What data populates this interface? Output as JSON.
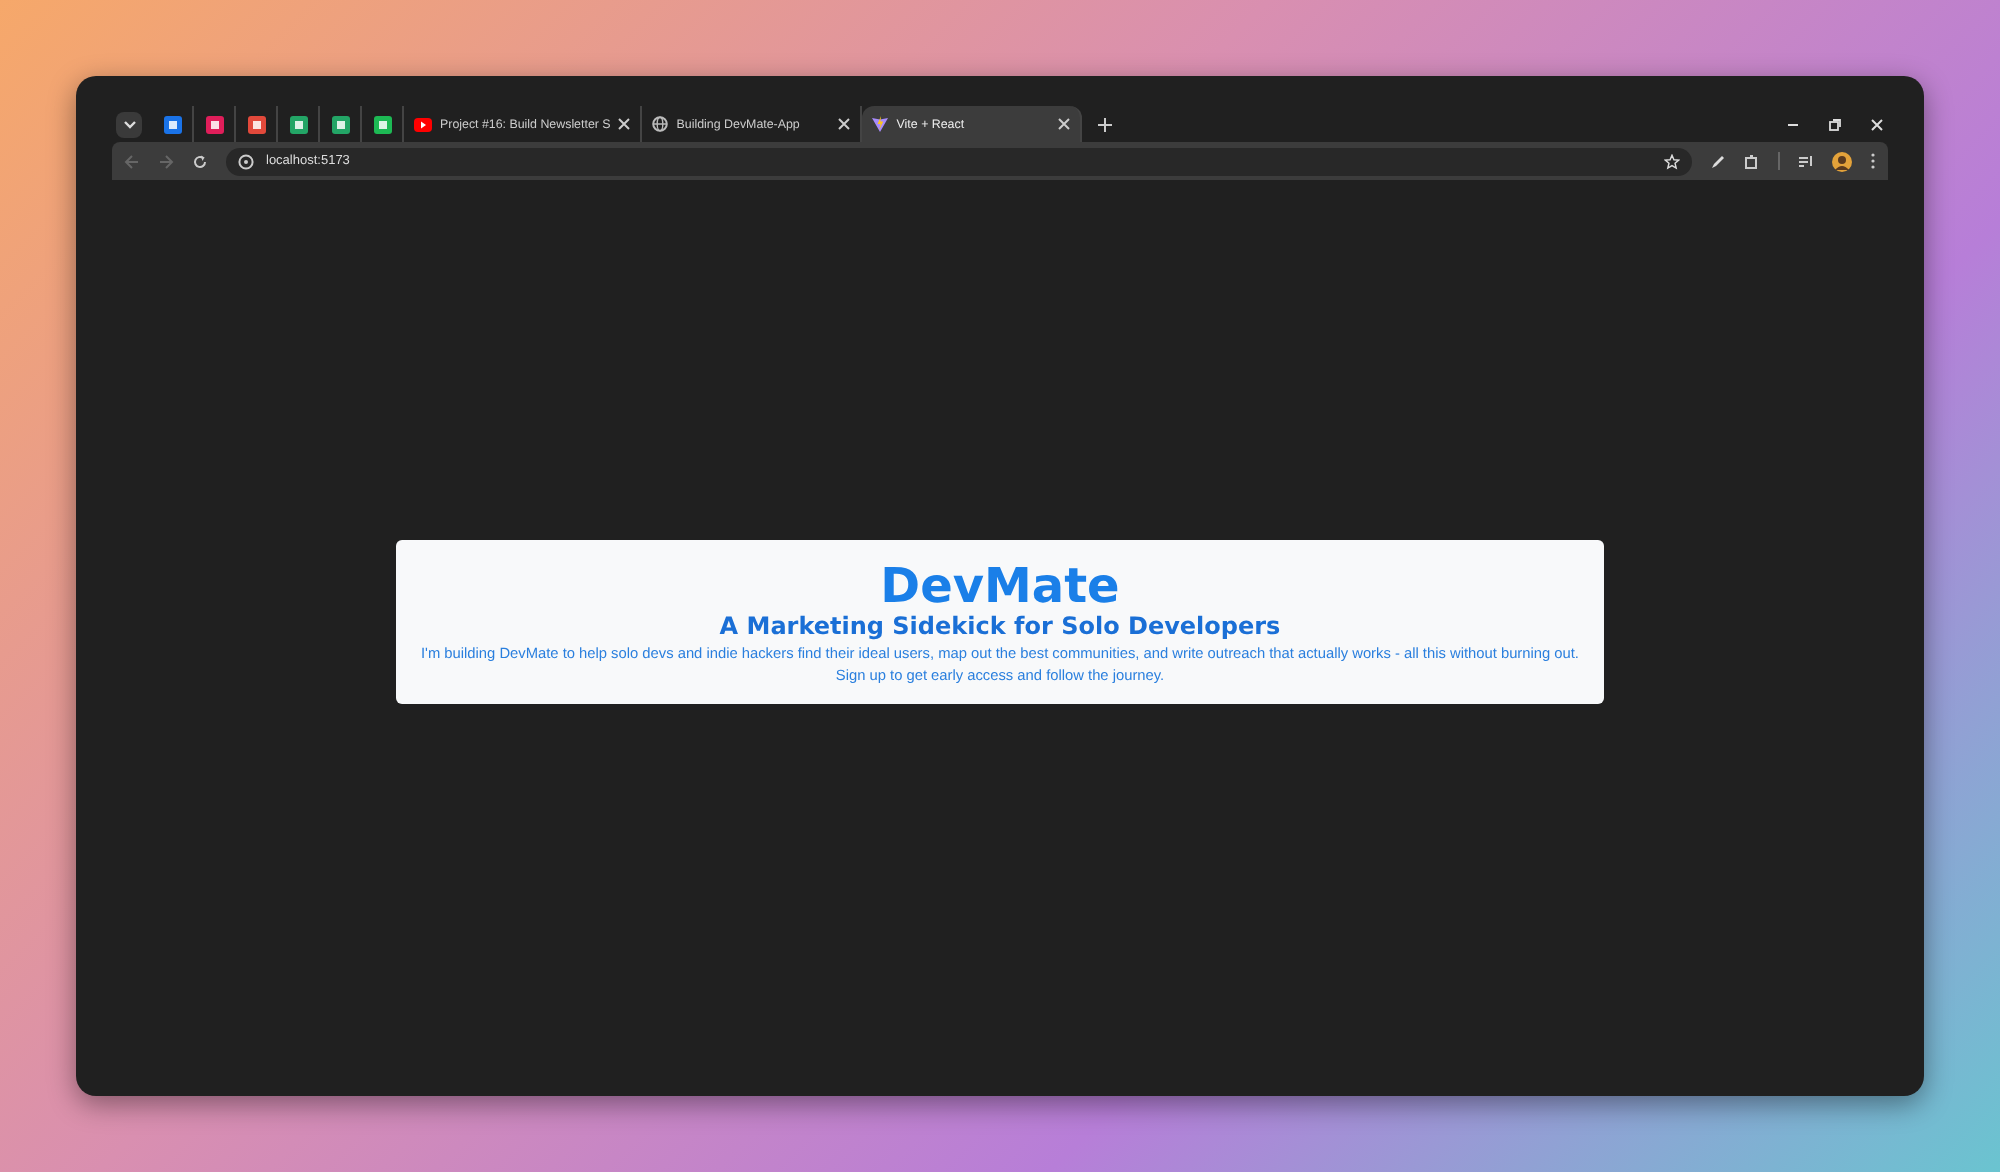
{
  "tabs": [
    {
      "kind": "pinned",
      "color": "#1a73e8",
      "selected": false
    },
    {
      "kind": "pinned",
      "color": "#e01e5a",
      "selected": false
    },
    {
      "kind": "pinned",
      "color": "#e2493b",
      "selected": false
    },
    {
      "kind": "pinned",
      "color": "#23a566",
      "selected": false
    },
    {
      "kind": "pinned",
      "color": "#23a566",
      "selected": false
    },
    {
      "kind": "pinned",
      "color": "#1db954",
      "selected": false
    },
    {
      "kind": "page",
      "title": "Project #16: Build Newsletter S",
      "selected": false
    },
    {
      "kind": "page",
      "title": "Building DevMate-App",
      "selected": false
    },
    {
      "kind": "page",
      "title": "Vite + React",
      "selected": true
    }
  ],
  "address_bar": {
    "url": "localhost:5173"
  },
  "card": {
    "title": "DevMate",
    "subtitle": "A Marketing Sidekick for Solo Developers",
    "lines": [
      "I'm building DevMate to help solo devs and indie hackers find their ideal users, map out the best communities, and write outreach that actually works - all this without burning out.",
      "Sign up to get early access and follow the journey."
    ]
  }
}
